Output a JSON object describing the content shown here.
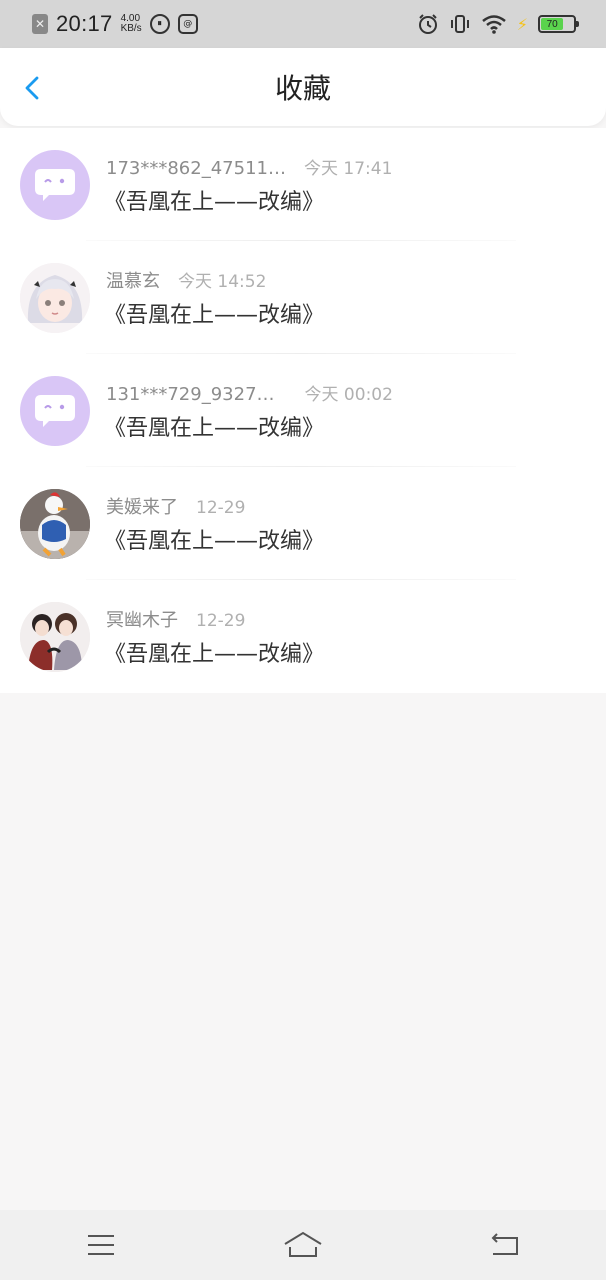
{
  "status_bar": {
    "time": "20:17",
    "speed_value": "4.00",
    "speed_unit": "KB/s",
    "battery": "70",
    "icons": [
      "close-badge-icon",
      "data-saver-icon",
      "message-icon",
      "alarm-icon",
      "vibrate-icon",
      "wifi-icon",
      "charging-icon",
      "battery-icon"
    ]
  },
  "header": {
    "title": "收藏",
    "back_icon": "chevron-left-icon",
    "accent_color": "#1a9bf0"
  },
  "favorites": [
    {
      "name": "173***862_47511…",
      "time": "今天 17:41",
      "book": "《吾凰在上——改编》",
      "avatar": "default-chat-avatar"
    },
    {
      "name": "温慕玄",
      "time": "今天 14:52",
      "book": "《吾凰在上——改编》",
      "avatar": "anime-girl-avatar"
    },
    {
      "name": "131***729_9327…",
      "time": "今天 00:02",
      "book": "《吾凰在上——改编》",
      "avatar": "default-chat-avatar"
    },
    {
      "name": "美媛来了",
      "time": "12-29",
      "book": "《吾凰在上——改编》",
      "avatar": "duck-avatar"
    },
    {
      "name": "冥幽木子",
      "time": "12-29",
      "book": "《吾凰在上——改编》",
      "avatar": "couple-avatar"
    }
  ],
  "nav_bar": {
    "buttons": [
      "menu-icon",
      "home-icon",
      "back-icon"
    ]
  }
}
